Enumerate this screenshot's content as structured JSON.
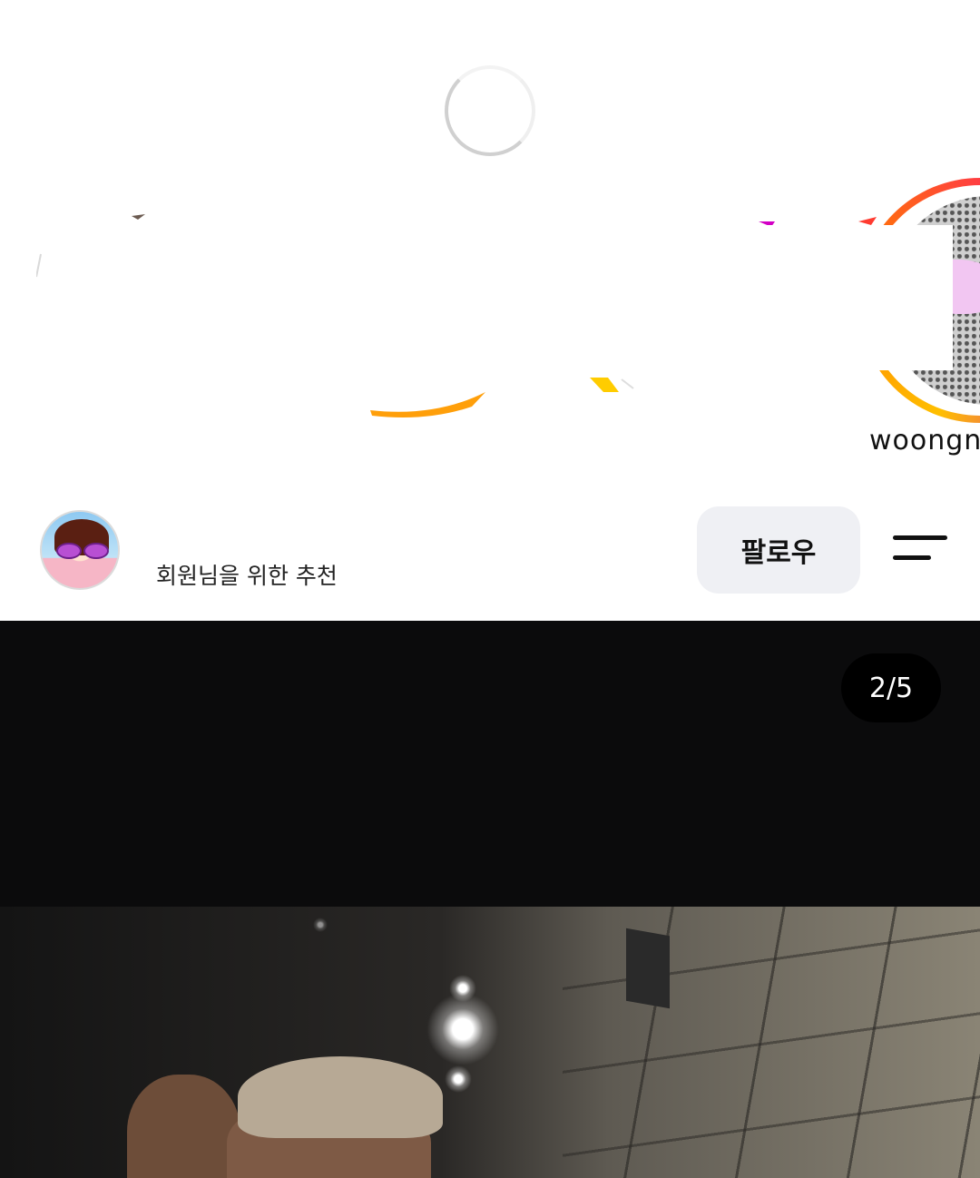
{
  "loading": {
    "spinner_icon": "loading-spinner-icon"
  },
  "stories": {
    "items": [
      {
        "username": ""
      },
      {
        "username": "woongni."
      }
    ],
    "ring_colors": [
      "#ffbf00",
      "#ff7a00",
      "#ff2d55",
      "#d300c5"
    ]
  },
  "post": {
    "header": {
      "avatar_icon": "profile-avatar",
      "caption": "회원님을 위한 추천",
      "follow_label": "팔로우",
      "menu_icon": "menu-icon"
    },
    "media": {
      "page_indicator": "2/5",
      "background_color": "#0b0b0c"
    }
  },
  "colors": {
    "follow_button_bg": "#eff0f4",
    "text_primary": "#111111"
  }
}
